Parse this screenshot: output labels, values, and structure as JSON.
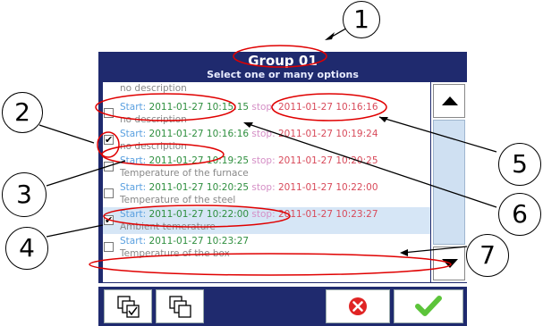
{
  "dialog": {
    "title": "Group 01",
    "subtitle": "Select one or many options"
  },
  "list": {
    "rows": [
      {
        "checked": false,
        "selected": false,
        "start_label": "",
        "start_value": "",
        "stop_label": "",
        "stop_value": "",
        "description": "no description"
      },
      {
        "checked": false,
        "selected": false,
        "start_label": "Start:",
        "start_value": "2011-01-27 10:15:15",
        "stop_label": "stop:",
        "stop_value": "2011-01-27 10:16:16",
        "description": "no description"
      },
      {
        "checked": true,
        "selected": false,
        "start_label": "Start:",
        "start_value": "2011-01-27 10:16:16",
        "stop_label": "stop:",
        "stop_value": "2011-01-27 10:19:24",
        "description": "no description"
      },
      {
        "checked": false,
        "selected": false,
        "start_label": "Start:",
        "start_value": "2011-01-27 10:19:25",
        "stop_label": "stop:",
        "stop_value": "2011-01-27 10:20:25",
        "description": "Temperature of the furnace"
      },
      {
        "checked": false,
        "selected": false,
        "start_label": "Start:",
        "start_value": "2011-01-27 10:20:25",
        "stop_label": "stop:",
        "stop_value": "2011-01-27 10:22:00",
        "description": "Temperature of the steel"
      },
      {
        "checked": true,
        "selected": true,
        "start_label": "Start:",
        "start_value": "2011-01-27 10:22:00",
        "stop_label": "stop:",
        "stop_value": "2011-01-27 10:23:27",
        "description": "Ambient temerature"
      },
      {
        "checked": false,
        "selected": false,
        "start_label": "Start:",
        "start_value": "2011-01-27 10:23:27",
        "stop_label": "",
        "stop_value": "",
        "description": "Temperature of the box"
      }
    ]
  },
  "toolbar": {
    "select_all_icon": "select-all-icon",
    "deselect_all_icon": "deselect-all-icon",
    "cancel_icon": "cancel-icon",
    "confirm_icon": "confirm-icon",
    "cancel_color": "#e02424",
    "confirm_color": "#5cc43a"
  },
  "annotations": {
    "callouts": [
      "1",
      "2",
      "3",
      "4",
      "5",
      "6",
      "7"
    ],
    "highlight_color": "#e00000"
  }
}
